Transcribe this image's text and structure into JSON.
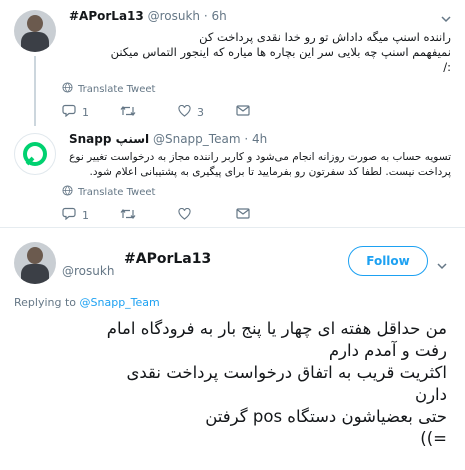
{
  "tweet1": {
    "name": "#APorLa13",
    "handle": "@rosukh",
    "time": "· 6h",
    "lines": [
      "راننده اسنپ میگه داداش تو رو خدا نقدی پرداخت کن",
      "نمیفهمم اسنپ چه بلایی سر این بچاره ها میاره که اینجور التماس میکنن",
      ":/"
    ],
    "translate": "Translate Tweet",
    "replies": "1",
    "retweets": "",
    "likes": "3"
  },
  "tweet2": {
    "name": "Snapp اسنپ",
    "handle": "@Snapp_Team",
    "time": "· 4h",
    "lines": [
      "تسویه حساب به صورت روزانه انجام می‌شود و کاربر راننده مجاز به درخواست تغییر نوع",
      "پرداخت نیست. لطفا کد سفرتون رو بفرمایید تا برای پیگیری به پشتیبانی اعلام شود."
    ],
    "translate": "Translate Tweet",
    "replies": "1",
    "retweets": "",
    "likes": ""
  },
  "main": {
    "name": "#APorLa13",
    "handle": "@rosukh",
    "follow": "Follow",
    "replying_prefix": "Replying to",
    "replying_to": "@Snapp_Team",
    "lines": [
      "من حداقل هفته ای چهار یا پنج بار به فرودگاه امام",
      "رفت و آمدم دارم",
      "اکثریت قریب به اتفاق درخواست پرداخت نقدی",
      "دارن",
      "حتی بعضیاشون دستگاه pos گرفتن",
      "=))"
    ]
  },
  "colors": {
    "accent": "#1da1f2",
    "muted": "#657786",
    "line": "#ccd6dd",
    "snapp": "#00d170"
  },
  "icons": [
    "globe-icon",
    "reply-icon",
    "retweet-icon",
    "like-icon",
    "dm-icon",
    "snapp-logo-icon"
  ]
}
